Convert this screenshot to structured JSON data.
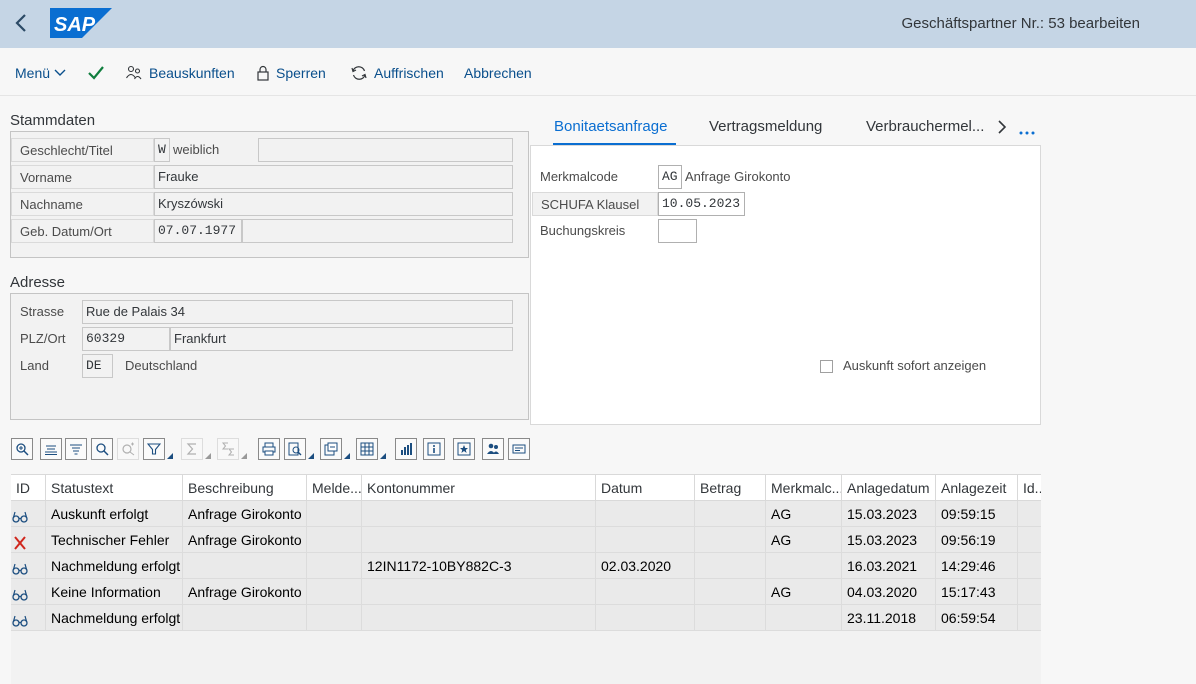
{
  "shell": {
    "title": "Geschäftspartner Nr.: 53 bearbeiten",
    "logo_text": "SAP",
    "brand_color": "#0a6ed1"
  },
  "toolbar": {
    "menu": "Menü",
    "beauskunften": "Beauskunften",
    "sperren": "Sperren",
    "auffrischen": "Auffrischen",
    "abbrechen": "Abbrechen"
  },
  "stammdaten": {
    "title": "Stammdaten",
    "geschlecht_label": "Geschlecht/Titel",
    "geschlecht_code": "W",
    "geschlecht_text": "weiblich",
    "titel": "",
    "vorname_label": "Vorname",
    "vorname": "Frauke",
    "nachname_label": "Nachname",
    "nachname": "Kryszówski",
    "geb_label": "Geb. Datum/Ort",
    "geb_datum": "07.07.1977",
    "geb_ort": ""
  },
  "adresse": {
    "title": "Adresse",
    "strasse_label": "Strasse",
    "strasse": "Rue de Palais 34",
    "plz_label": "PLZ/Ort",
    "plz": "60329",
    "ort": "Frankfurt",
    "land_label": "Land",
    "land_code": "DE",
    "land_text": "Deutschland"
  },
  "tabs": [
    {
      "label": "Bonitaetsanfrage",
      "active": true
    },
    {
      "label": "Vertragsmeldung",
      "active": false
    },
    {
      "label": "Verbrauchermel...",
      "active": false
    }
  ],
  "bonitaet": {
    "merkmalcode_label": "Merkmalcode",
    "merkmalcode": "AG",
    "merkmalcode_text": "Anfrage Girokonto",
    "schufa_label": "SCHUFA Klausel",
    "schufa": "10.05.2023",
    "buchungskreis_label": "Buchungskreis",
    "buchungskreis": "",
    "auskunft_label": "Auskunft sofort anzeigen",
    "auskunft_checked": false
  },
  "table": {
    "columns": [
      "ID",
      "Statustext",
      "Beschreibung",
      "Melde...",
      "Kontonummer",
      "Datum",
      "Betrag",
      "Merkmalc...",
      "Anlagedatum",
      "Anlagezeit",
      "Id..."
    ],
    "rows": [
      {
        "icon": "glasses",
        "status": "Auskunft erfolgt",
        "beschreibung": "Anfrage Girokonto",
        "melde": "",
        "konto": "",
        "datum": "",
        "betrag": "",
        "merkmal": "AG",
        "anlagedatum": "15.03.2023",
        "anlagezeit": "09:59:15",
        "id": ""
      },
      {
        "icon": "error",
        "status": "Technischer Fehler",
        "beschreibung": "Anfrage Girokonto",
        "melde": "",
        "konto": "",
        "datum": "",
        "betrag": "",
        "merkmal": "AG",
        "anlagedatum": "15.03.2023",
        "anlagezeit": "09:56:19",
        "id": ""
      },
      {
        "icon": "glasses",
        "status": "Nachmeldung erfolgt",
        "beschreibung": "",
        "melde": "",
        "konto": "12IN1172-10BY882C-3",
        "datum": "02.03.2020",
        "betrag": "",
        "merkmal": "",
        "anlagedatum": "16.03.2021",
        "anlagezeit": "14:29:46",
        "id": ""
      },
      {
        "icon": "glasses",
        "status": "Keine Information",
        "beschreibung": "Anfrage Girokonto",
        "melde": "",
        "konto": "",
        "datum": "",
        "betrag": "",
        "merkmal": "AG",
        "anlagedatum": "04.03.2020",
        "anlagezeit": "15:17:43",
        "id": ""
      },
      {
        "icon": "glasses",
        "status": "Nachmeldung erfolgt",
        "beschreibung": "",
        "melde": "",
        "konto": "",
        "datum": "",
        "betrag": "",
        "merkmal": "",
        "anlagedatum": "23.11.2018",
        "anlagezeit": "06:59:54",
        "id": ""
      }
    ]
  }
}
